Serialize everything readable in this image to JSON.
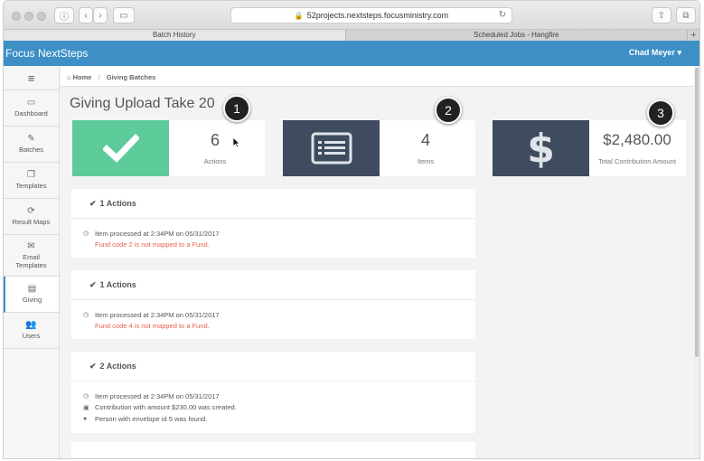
{
  "browser": {
    "url": "52projects.nextsteps.focusministry.com",
    "tabs": [
      "Batch History",
      "Scheduled Jobs - Hangfire"
    ]
  },
  "app": {
    "brand": "Focus NextSteps",
    "user": "Chad Meyer"
  },
  "sidebar": {
    "items": [
      {
        "label": "Dashboard"
      },
      {
        "label": "Batches"
      },
      {
        "label": "Templates"
      },
      {
        "label": "Result Maps"
      },
      {
        "label": "Email Templates"
      },
      {
        "label": "Giving"
      },
      {
        "label": "Users"
      }
    ]
  },
  "breadcrumb": {
    "home": "Home",
    "current": "Giving Batches"
  },
  "page": {
    "title": "Giving Upload Take 20"
  },
  "stats": [
    {
      "value": "6",
      "label": "Actions",
      "color": "#5ecb9b",
      "icon": "check-icon",
      "callout": "1"
    },
    {
      "value": "4",
      "label": "Items",
      "color": "#3f4b5e",
      "icon": "list-icon",
      "callout": "2"
    },
    {
      "value": "$2,480.00",
      "label": "Total Contribution Amount",
      "color": "#3f4b5e",
      "icon": "dollar-icon",
      "callout": "3"
    }
  ],
  "cards": [
    {
      "title": "1 Actions",
      "lines": [
        {
          "icon": "clock-icon",
          "text": "Item processed at 2:34PM on 05/31/2017",
          "error": false
        },
        {
          "icon": "",
          "text": "Fund code 2 is not mapped to a Fund.",
          "error": true
        }
      ]
    },
    {
      "title": "1 Actions",
      "lines": [
        {
          "icon": "clock-icon",
          "text": "Item processed at 2:34PM on 05/31/2017",
          "error": false
        },
        {
          "icon": "",
          "text": "Fund code 4 is not mapped to a Fund.",
          "error": true
        }
      ]
    },
    {
      "title": "2 Actions",
      "lines": [
        {
          "icon": "clock-icon",
          "text": "Item processed at 2:34PM on 05/31/2017",
          "error": false
        },
        {
          "icon": "money-icon",
          "text": "Contribution with amount $230.00 was created.",
          "error": false
        },
        {
          "icon": "person-icon",
          "text": "Person with envelope id 5 was found.",
          "error": false
        }
      ]
    }
  ],
  "colors": {
    "header": "#3d8fc6",
    "error": "#e8604c"
  }
}
